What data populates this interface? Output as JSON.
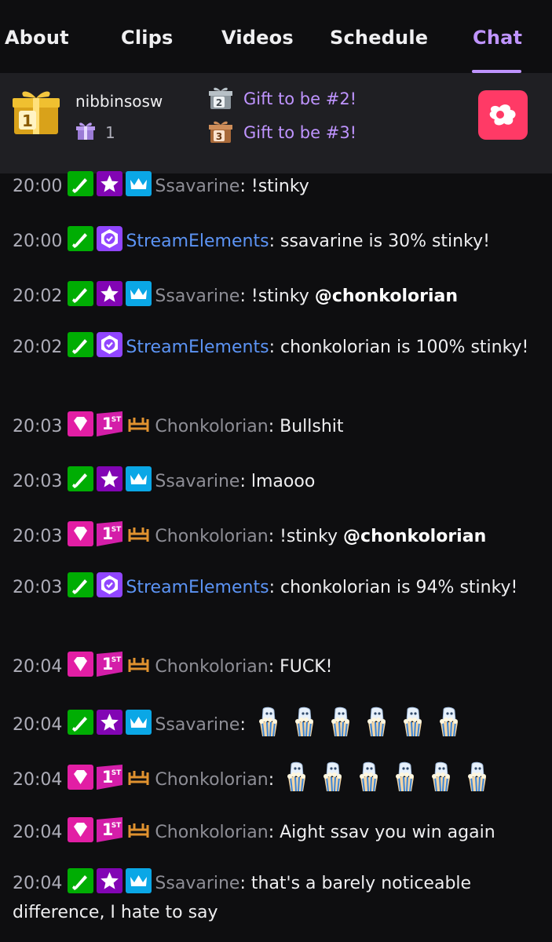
{
  "nav": {
    "tabs": [
      {
        "label": "About"
      },
      {
        "label": "Clips"
      },
      {
        "label": "Videos"
      },
      {
        "label": "Schedule"
      },
      {
        "label": "Chat",
        "active": true
      }
    ]
  },
  "gift_board": {
    "leader_name": "nibbinsosw",
    "leader_rank": "1",
    "leader_count": "1",
    "slots": [
      {
        "rank": "2",
        "label": "Gift to be #2!"
      },
      {
        "rank": "3",
        "label": "Gift to be #3!"
      }
    ],
    "brand_icon": "brand-logo-icon",
    "accent_color": "#bf94ff",
    "brand_color": "#ff3a66"
  },
  "chat": {
    "messages": [
      {
        "time": "20:00",
        "user": "Ssavarine",
        "sep": ":",
        "text": " !stinky"
      },
      {
        "time": "20:00",
        "user": "StreamElements",
        "sep": ":",
        "text": " ssavarine is 30% stinky!"
      },
      {
        "time": "20:02",
        "user": "Ssavarine",
        "sep": ":",
        "text": " !stinky ",
        "mention": "@chonkolorian"
      },
      {
        "time": "20:02",
        "user": "StreamElements",
        "sep": ":",
        "text": " chonkolorian is 100% stinky!"
      },
      {
        "time": "20:03",
        "user": "Chonkolorian",
        "sep": ":",
        "text": " Bullshit"
      },
      {
        "time": "20:03",
        "user": "Ssavarine",
        "sep": ":",
        "text": " lmaooo"
      },
      {
        "time": "20:03",
        "user": "Chonkolorian",
        "sep": ":",
        "text": " !stinky ",
        "mention": "@chonkolorian"
      },
      {
        "time": "20:03",
        "user": "StreamElements",
        "sep": ":",
        "text": " chonkolorian is 94% stinky!"
      },
      {
        "time": "20:04",
        "user": "Chonkolorian",
        "sep": ":",
        "text": " FUCK!"
      },
      {
        "time": "20:04",
        "user": "Ssavarine",
        "sep": ":",
        "text": "",
        "emote_count": 6
      },
      {
        "time": "20:04",
        "user": "Chonkolorian",
        "sep": ":",
        "text": "",
        "emote_count": 6
      },
      {
        "time": "20:04",
        "user": "Chonkolorian",
        "sep": ":",
        "text": " Aight ssav you win again"
      },
      {
        "time": "20:04",
        "user": "Ssavarine",
        "sep": ":",
        "text": " that's a barely noticeable difference, I hate to say"
      }
    ],
    "badge_1st": "1ST"
  }
}
